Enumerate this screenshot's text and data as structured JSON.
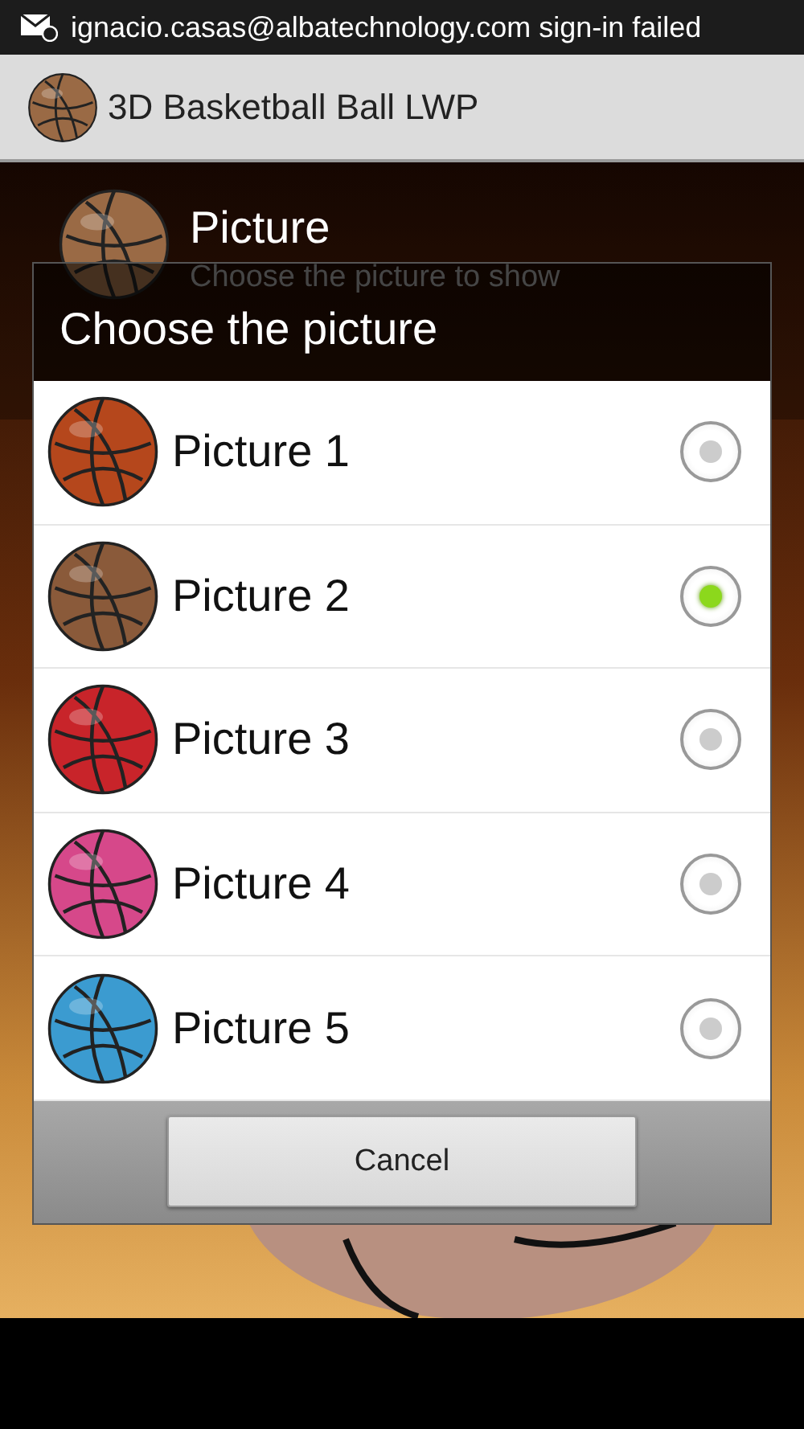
{
  "status_bar": {
    "notification": "ignacio.casas@albatechnology.com sign-in failed"
  },
  "action_bar": {
    "title": "3D Basketball Ball LWP"
  },
  "settings": [
    {
      "title": "Picture",
      "summary": "Choose the picture to show"
    }
  ],
  "dialog": {
    "title": "Choose the picture",
    "options": [
      {
        "label": "Picture 1",
        "color": "#b5471c",
        "selected": false
      },
      {
        "label": "Picture 2",
        "color": "#8a5a3a",
        "selected": true
      },
      {
        "label": "Picture 3",
        "color": "#c8242a",
        "selected": false
      },
      {
        "label": "Picture 4",
        "color": "#d6488a",
        "selected": false
      },
      {
        "label": "Picture 5",
        "color": "#3b9bd0",
        "selected": false
      }
    ],
    "buttons": [
      "Cancel"
    ]
  }
}
